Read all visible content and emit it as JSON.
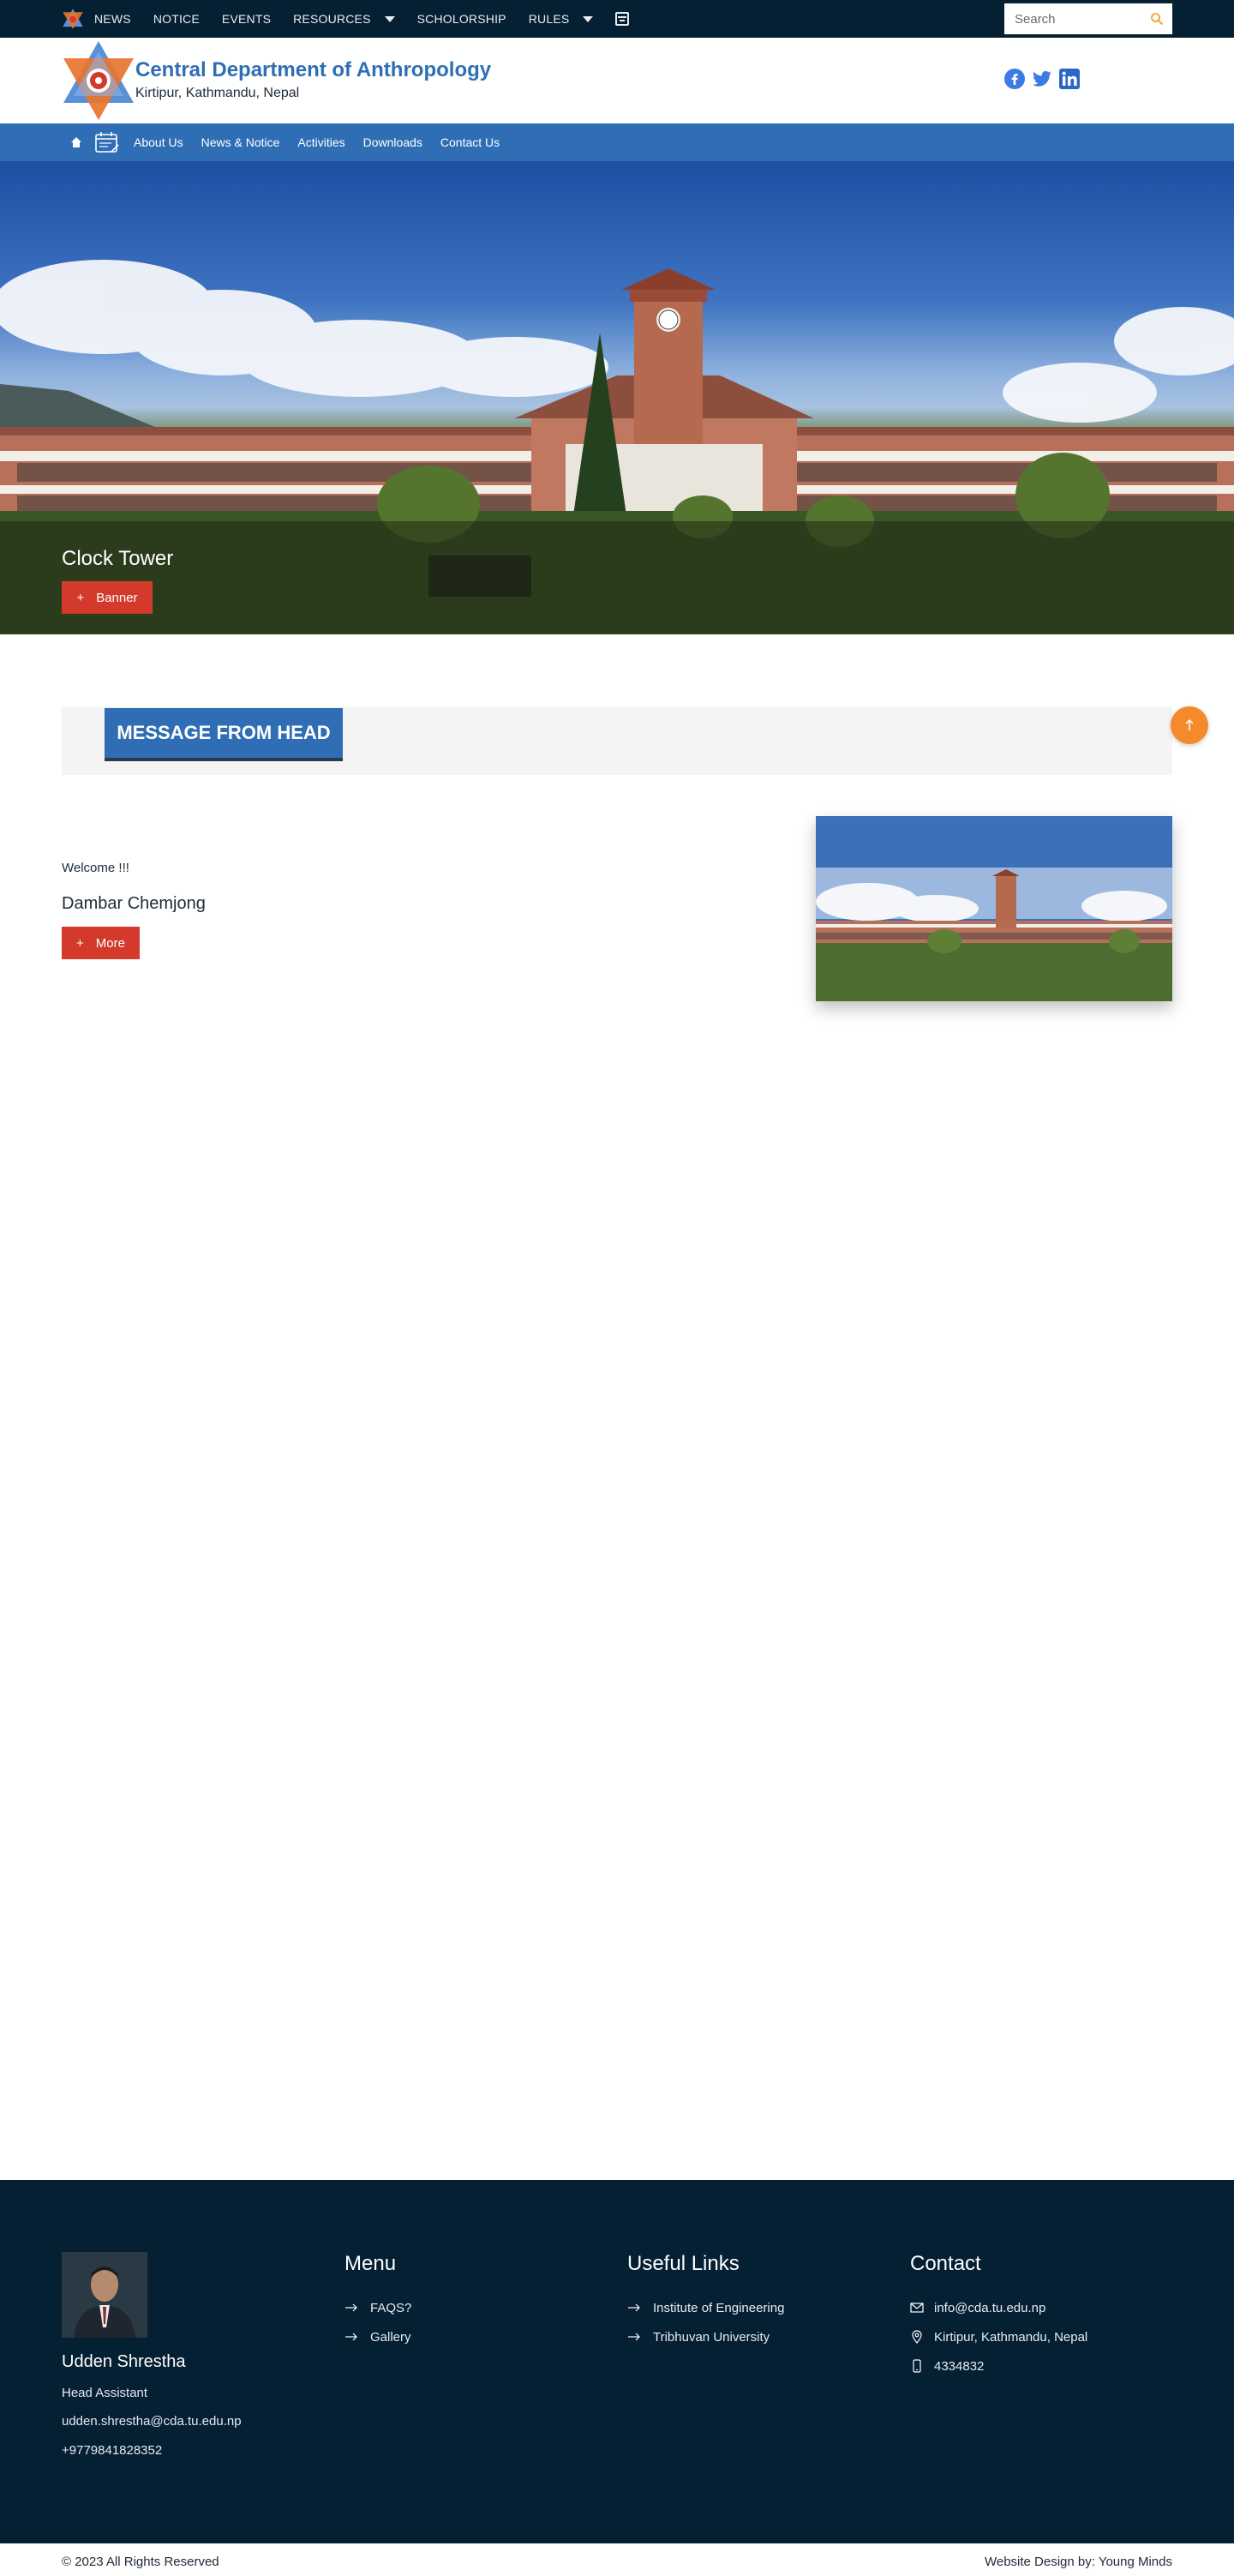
{
  "topbar": {
    "links": [
      "NEWS",
      "NOTICE",
      "EVENTS",
      "RESOURCES",
      "SCHOLORSHIP",
      "RULES"
    ],
    "search_placeholder": "Search"
  },
  "header": {
    "title": "Central Department of Anthropology",
    "subtitle": "Kirtipur, Kathmandu, Nepal"
  },
  "nav": {
    "links": [
      "About Us",
      "News & Notice",
      "Activities",
      "Downloads",
      "Contact Us"
    ]
  },
  "hero": {
    "title": "Clock Tower",
    "button_label": "Banner"
  },
  "message": {
    "heading": "MESSAGE FROM HEAD",
    "greeting": "Welcome !!!",
    "name": "Dambar Chemjong",
    "button_label": "More"
  },
  "footer": {
    "person": {
      "name": "Udden Shrestha",
      "role": "Head Assistant",
      "email": "udden.shrestha@cda.tu.edu.np",
      "phone": "+9779841828352"
    },
    "menu": {
      "title": "Menu",
      "items": [
        "FAQS?",
        "Gallery"
      ]
    },
    "useful_links": {
      "title": "Useful Links",
      "items": [
        "Institute of Engineering",
        "Tribhuvan University"
      ]
    },
    "contact": {
      "title": "Contact",
      "email": "info@cda.tu.edu.np",
      "address": "Kirtipur, Kathmandu, Nepal",
      "phone": "4334832"
    },
    "copyright": "© 2023 All Rights Reserved",
    "credit": "Website Design by: Young Minds"
  },
  "colors": {
    "primary_blue": "#2f6eb5",
    "dark_navy": "#051f33",
    "accent_red": "#d33a2c",
    "accent_orange": "#f58a2a"
  }
}
